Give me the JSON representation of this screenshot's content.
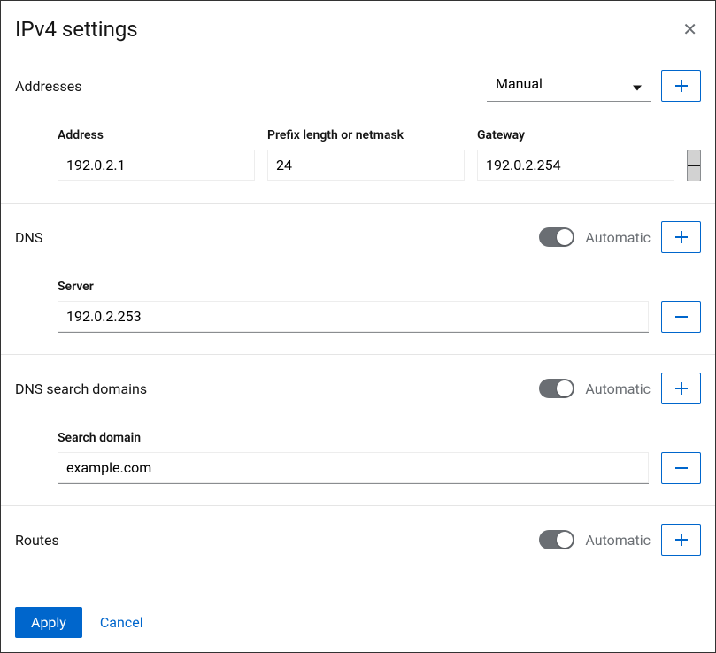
{
  "title": "IPv4 settings",
  "addresses": {
    "label": "Addresses",
    "mode_selected": "Manual",
    "columns": {
      "address": "Address",
      "prefix": "Prefix length or netmask",
      "gateway": "Gateway"
    },
    "rows": [
      {
        "address": "192.0.2.1",
        "prefix": "24",
        "gateway": "192.0.2.254"
      }
    ]
  },
  "dns": {
    "label": "DNS",
    "automatic_label": "Automatic",
    "server_label": "Server",
    "rows": [
      {
        "server": "192.0.2.253"
      }
    ]
  },
  "search_domains": {
    "label": "DNS search domains",
    "automatic_label": "Automatic",
    "domain_label": "Search domain",
    "rows": [
      {
        "domain": "example.com"
      }
    ]
  },
  "routes": {
    "label": "Routes",
    "automatic_label": "Automatic"
  },
  "footer": {
    "apply": "Apply",
    "cancel": "Cancel"
  }
}
